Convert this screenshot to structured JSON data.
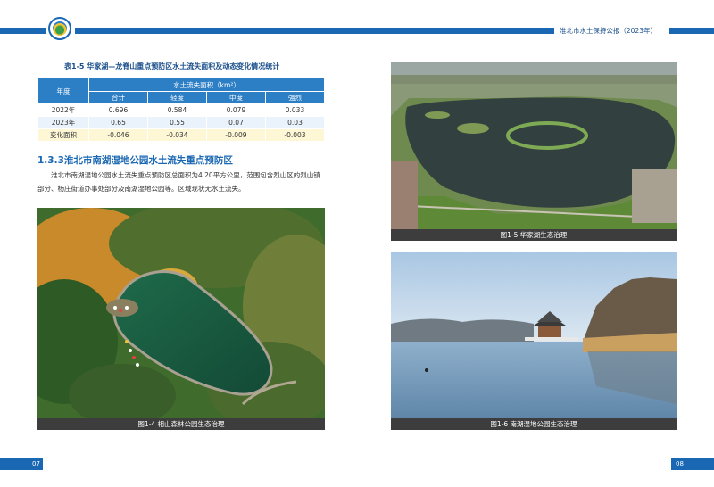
{
  "header": {
    "title": "淮北市水土保持公报（2023年）",
    "colors": {
      "brand_blue": "#1a67b3",
      "table_blue": "#2c7ec5"
    },
    "logo": "emblem-logo"
  },
  "table": {
    "title": "表1-5  华家湖—龙脊山重点预防区水土流失面积及动态变化情况统计",
    "row_header": "年度",
    "group_header": "水土流失面积（km²）",
    "columns": [
      "合计",
      "轻度",
      "中度",
      "强烈"
    ],
    "rows": [
      {
        "label": "2022年",
        "values": [
          "0.696",
          "0.584",
          "0.079",
          "0.033"
        ]
      },
      {
        "label": "2023年",
        "values": [
          "0.65",
          "0.55",
          "0.07",
          "0.03"
        ]
      },
      {
        "label": "变化面积",
        "values": [
          "-0.046",
          "-0.034",
          "-0.009",
          "-0.003"
        ]
      }
    ]
  },
  "section": {
    "title": "1.3.3淮北市南湖湿地公园水土流失重点预防区",
    "paragraph": "淮北市南湖湿地公园水土流失重点预防区总面积为4.20平方公里，范围包含烈山区的烈山镇部分、杨庄街道办事处部分及南湖湿地公园等。区域现状无水土流失。"
  },
  "figures": {
    "fig14": "图1-4 相山森林公园生态治理",
    "fig15": "图1-5  华家湖生态治理",
    "fig16": "图1-6 南湖湿地公园生态治理"
  },
  "footer": {
    "page_left": "07",
    "page_right": "08"
  }
}
